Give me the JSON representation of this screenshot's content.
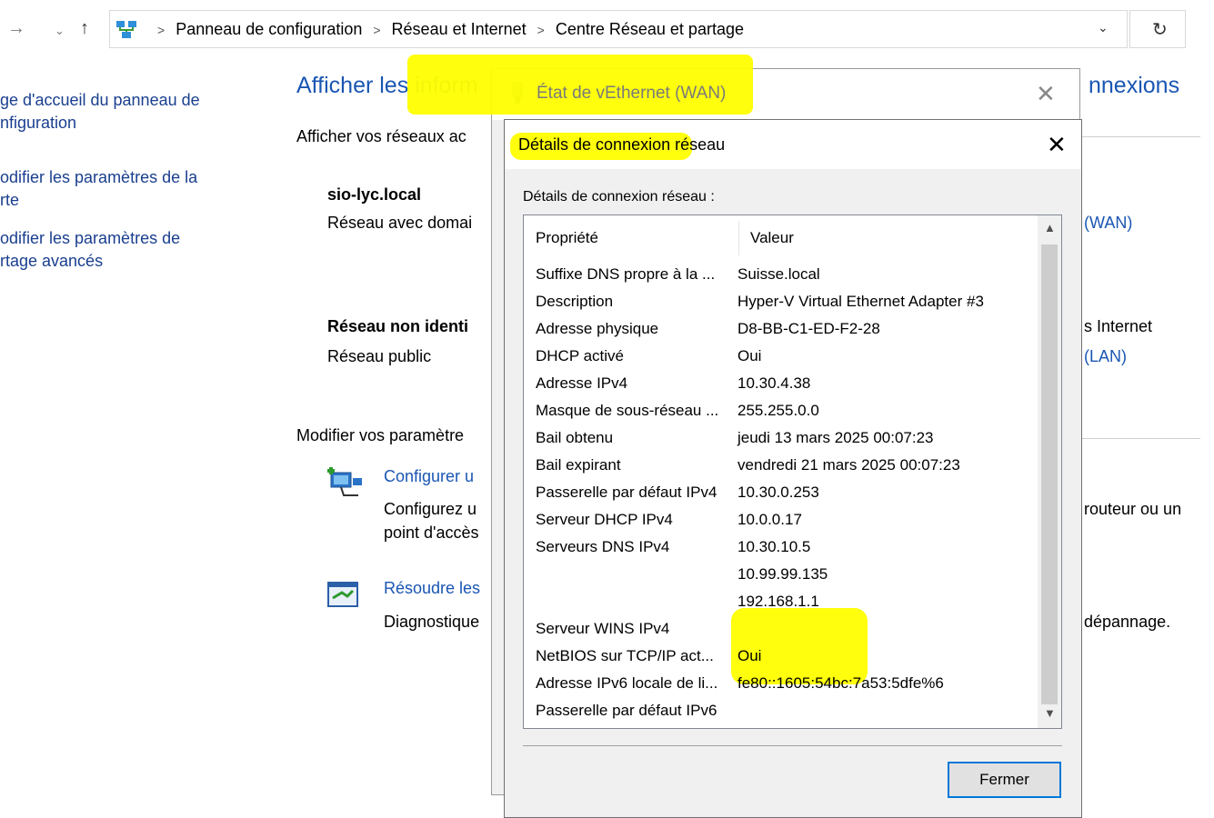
{
  "address_bar": {
    "breadcrumbs": [
      "Panneau de configuration",
      "Réseau et Internet",
      "Centre Réseau et partage"
    ]
  },
  "left_panel": {
    "links": [
      [
        "ge d'accueil du panneau de",
        "nfiguration"
      ],
      [
        "odifier les paramètres de la",
        "rte"
      ],
      [
        "odifier les paramètres de",
        "rtage avancés"
      ]
    ]
  },
  "main": {
    "title_left": "Afficher les inform",
    "title_right": "nnexions",
    "subtitle": "Afficher vos réseaux ac",
    "network1": {
      "name": "sio-lyc.local",
      "type": "Réseau avec domai",
      "link": "(WAN)"
    },
    "network2": {
      "name": "Réseau non identi",
      "type": "Réseau public",
      "access": "s Internet",
      "link": "(LAN)"
    },
    "modify_heading": "Modifier vos paramètre",
    "configure_link": "Configurer u",
    "configure_desc_1": "Configurez u",
    "configure_desc_1_right": "routeur ou un",
    "configure_desc_2": "point d'accès",
    "troubleshoot_link": "Résoudre les",
    "troubleshoot_desc": "Diagnostique",
    "troubleshoot_desc_right": "dépannage."
  },
  "dialog_status": {
    "title": "État de vEthernet (WAN)"
  },
  "dialog_details": {
    "title": "Détails de connexion réseau",
    "label": "Détails de connexion réseau :",
    "col_property": "Propriété",
    "col_value": "Valeur",
    "rows": [
      [
        "Suffixe DNS propre à la ...",
        "Suisse.local"
      ],
      [
        "Description",
        "Hyper-V Virtual Ethernet Adapter #3"
      ],
      [
        "Adresse physique",
        "D8-BB-C1-ED-F2-28"
      ],
      [
        "DHCP activé",
        "Oui"
      ],
      [
        "Adresse IPv4",
        "10.30.4.38"
      ],
      [
        "Masque de sous-réseau ...",
        "255.255.0.0"
      ],
      [
        "Bail obtenu",
        "jeudi 13 mars 2025 00:07:23"
      ],
      [
        "Bail expirant",
        "vendredi 21 mars 2025 00:07:23"
      ],
      [
        "Passerelle par défaut IPv4",
        "10.30.0.253"
      ],
      [
        "Serveur DHCP IPv4",
        "10.0.0.17"
      ],
      [
        "Serveurs DNS IPv4",
        "10.30.10.5"
      ],
      [
        "",
        "10.99.99.135"
      ],
      [
        "",
        "192.168.1.1"
      ],
      [
        "Serveur WINS IPv4",
        ""
      ],
      [
        "NetBIOS sur TCP/IP act...",
        "Oui"
      ],
      [
        "Adresse IPv6 locale de li...",
        "fe80::1605:54bc:7a53:5dfe%6"
      ],
      [
        "Passerelle par défaut IPv6",
        ""
      ]
    ],
    "close_button": "Fermer"
  },
  "colors": {
    "highlight": "#ffff00",
    "link": "#1a56b3",
    "focus_border": "#0078d7"
  }
}
